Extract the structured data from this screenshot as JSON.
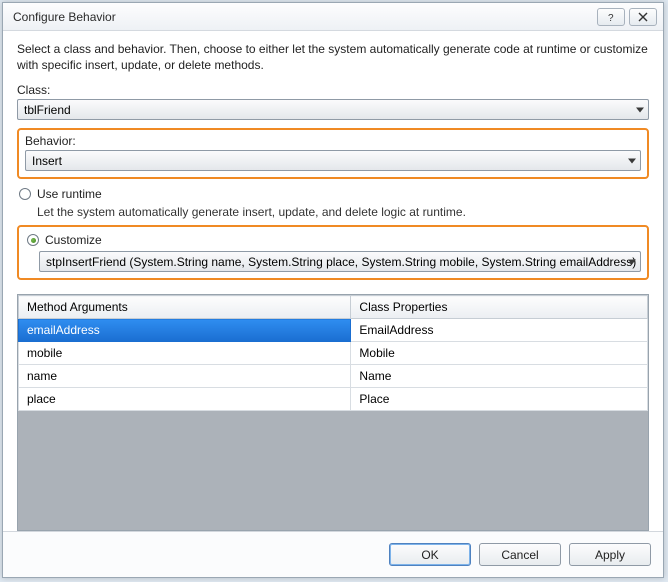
{
  "window": {
    "title": "Configure Behavior"
  },
  "intro": "Select a class and behavior.  Then, choose to either let the system automatically generate code at runtime or customize with specific insert, update, or delete methods.",
  "labels": {
    "class": "Class:",
    "behavior": "Behavior:"
  },
  "class_combo": {
    "value": "tblFriend"
  },
  "behavior_combo": {
    "value": "Insert"
  },
  "options": {
    "runtime_label": "Use runtime",
    "runtime_desc": "Let the system automatically generate insert, update, and delete logic at runtime.",
    "customize_label": "Customize",
    "method_value": "stpInsertFriend (System.String name, System.String place, System.String mobile, System.String emailAddress)"
  },
  "table": {
    "headers": {
      "args": "Method Arguments",
      "props": "Class Properties"
    },
    "rows": [
      {
        "arg": "emailAddress",
        "prop": "EmailAddress",
        "selected": true
      },
      {
        "arg": "mobile",
        "prop": "Mobile"
      },
      {
        "arg": "name",
        "prop": "Name"
      },
      {
        "arg": "place",
        "prop": "Place"
      }
    ]
  },
  "buttons": {
    "ok": "OK",
    "cancel": "Cancel",
    "apply": "Apply"
  }
}
